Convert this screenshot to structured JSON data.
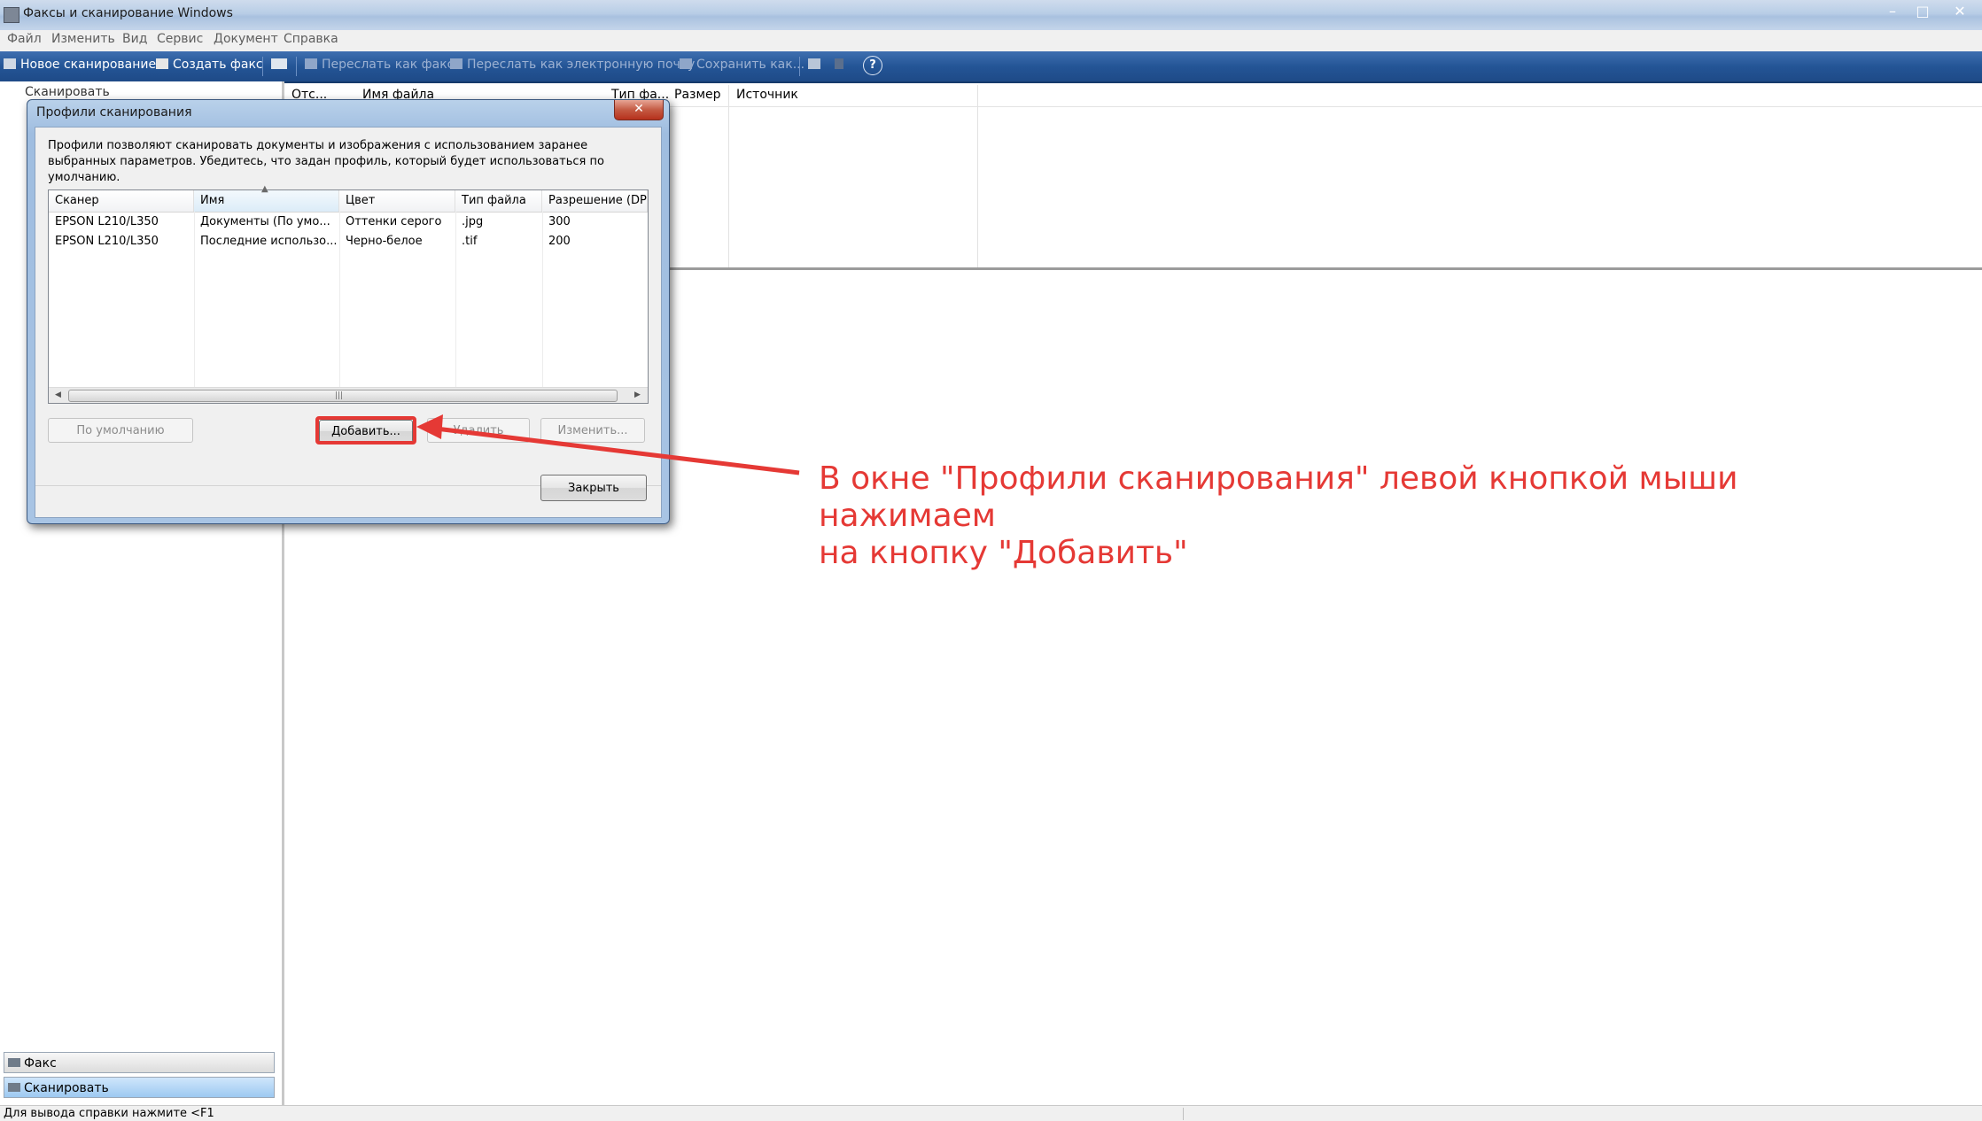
{
  "window": {
    "title": "Факсы и сканирование Windows",
    "controls": {
      "minimize": "–",
      "maximize": "□",
      "close": "✕"
    }
  },
  "menubar": {
    "items": [
      {
        "label": "Файл"
      },
      {
        "label": "Изменить"
      },
      {
        "label": "Вид"
      },
      {
        "label": "Сервис"
      },
      {
        "label": "Документ"
      },
      {
        "label": "Справка"
      }
    ]
  },
  "toolbar": {
    "new_scan": "Новое сканирование",
    "create_fax": "Создать факс",
    "forward_as_fax": "Переслать как факс",
    "forward_as_email": "Переслать как электронную почту",
    "save_as": "Сохранить как..."
  },
  "left_pane": {
    "tree_root": "Сканировать",
    "nav": {
      "fax": "Факс",
      "scan": "Сканировать"
    }
  },
  "main_list": {
    "columns": [
      "Отс...",
      "Имя файла",
      "Тип фа...",
      "Размер",
      "Источник"
    ]
  },
  "dialog": {
    "title": "Профили сканирования",
    "close_label": "✕",
    "description": "Профили позволяют сканировать документы и изображения с использованием заранее выбранных параметров. Убедитесь, что задан профиль, который будет использоваться по умолчанию.",
    "columns": [
      "Сканер",
      "Имя",
      "Цвет",
      "Тип файла",
      "Разрешение (DPI)"
    ],
    "rows": [
      [
        "EPSON L210/L350",
        "Документы (По умо...",
        "Оттенки серого",
        ".jpg",
        "300"
      ],
      [
        "EPSON L210/L350",
        "Последние использо...",
        "Черно-белое",
        ".tif",
        "200"
      ]
    ],
    "buttons": {
      "default": "По умолчанию",
      "add": "Добавить...",
      "delete": "Удалить",
      "edit": "Изменить...",
      "close": "Закрыть"
    }
  },
  "annotation": {
    "line1": "В окне \"Профили сканирования\" левой кнопкой мыши нажимаем",
    "line2": "на кнопку \"Добавить\"",
    "color": "#e53935"
  },
  "statusbar": {
    "text": "Для вывода справки нажмите <F1"
  },
  "colors": {
    "toolbar_bg": "#245596",
    "annotation_red": "#e53935",
    "selected_nav": "#9dc9f1"
  }
}
